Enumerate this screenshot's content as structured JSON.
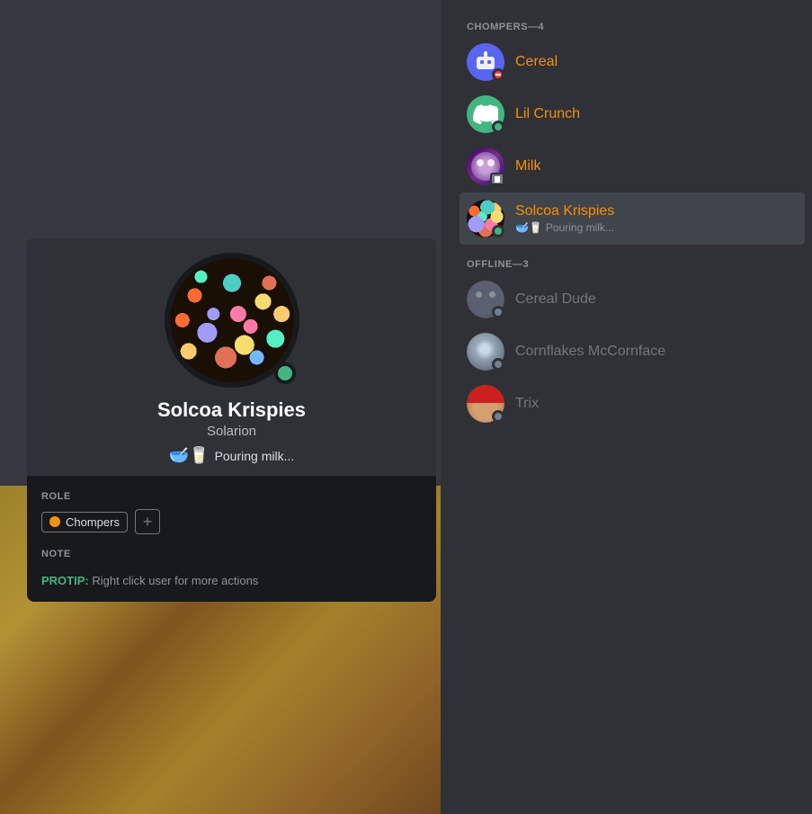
{
  "leftPanel": {
    "profileCard": {
      "username": "Solcoa Krispies",
      "discriminator": "Solarion",
      "statusText": "Pouring milk...",
      "statusEmojis": "🥣🥛",
      "onlineStatus": "online",
      "roleLabel": "ROLE",
      "roleName": "Chompers",
      "noteLabel": "NOTE",
      "protipLabel": "PROTIP:",
      "protipText": "Right click user for more actions"
    }
  },
  "rightPanel": {
    "categories": [
      {
        "id": "chompers",
        "label": "CHOMPERS—4",
        "members": [
          {
            "id": "cereal",
            "name": "Cereal",
            "status": "dnd",
            "avatarType": "robot",
            "online": true
          },
          {
            "id": "lil-crunch",
            "name": "Lil Crunch",
            "status": "online",
            "avatarType": "discord",
            "online": true
          },
          {
            "id": "milk",
            "name": "Milk",
            "status": "idle",
            "avatarType": "milk",
            "online": true
          },
          {
            "id": "solcoa-krispies",
            "name": "Solcoa Krispies",
            "status": "online",
            "avatarType": "solcoa",
            "online": true,
            "activity": "🥣🥛 Pouring milk...",
            "active": true
          }
        ]
      },
      {
        "id": "offline",
        "label": "OFFLINE—3",
        "members": [
          {
            "id": "cereal-dude",
            "name": "Cereal Dude",
            "status": "offline",
            "avatarType": "cereal-dude",
            "online": false
          },
          {
            "id": "cornflakes",
            "name": "Cornflakes McCornface",
            "status": "offline",
            "avatarType": "cornflakes",
            "online": false
          },
          {
            "id": "trix",
            "name": "Trix",
            "status": "offline",
            "avatarType": "trix",
            "online": false
          }
        ]
      }
    ]
  }
}
